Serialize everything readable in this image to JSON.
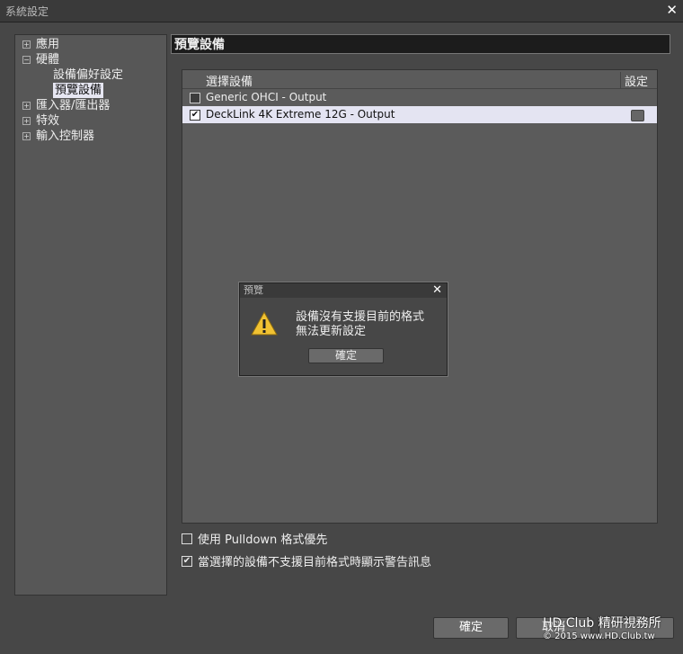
{
  "window": {
    "title": "系統設定",
    "close": "✕"
  },
  "tree": [
    {
      "label": "應用",
      "expander": "+"
    },
    {
      "label": "硬體",
      "expander": "−"
    },
    {
      "label": "設備偏好設定"
    },
    {
      "label": "預覽設備"
    },
    {
      "label": "匯入器/匯出器",
      "expander": "+"
    },
    {
      "label": "特效",
      "expander": "+"
    },
    {
      "label": "輸入控制器",
      "expander": "+"
    }
  ],
  "panel": {
    "title": "預覽設備"
  },
  "list": {
    "col_select": "選擇設備",
    "col_settings": "設定",
    "rows": [
      {
        "label": "Generic OHCI - Output",
        "checked": false
      },
      {
        "label": "DeckLink 4K Extreme 12G - Output",
        "checked": true
      }
    ]
  },
  "options": [
    {
      "label": "使用 Pulldown 格式優先",
      "checked": false
    },
    {
      "label": "當選擇的設備不支援目前格式時顯示警告訊息",
      "checked": true
    }
  ],
  "buttons": {
    "ok": "確定",
    "cancel": "取消"
  },
  "dialog": {
    "title": "預覽",
    "line1": "設備沒有支援目前的格式",
    "line2": "無法更新設定",
    "ok": "確定",
    "close": "✕"
  },
  "watermark": {
    "line1": "HD.Club 精研視務所",
    "line2": "© 2015  www.HD.Club.tw"
  },
  "marks": {
    "check": "✔",
    "plus": "+",
    "minus": "−"
  }
}
